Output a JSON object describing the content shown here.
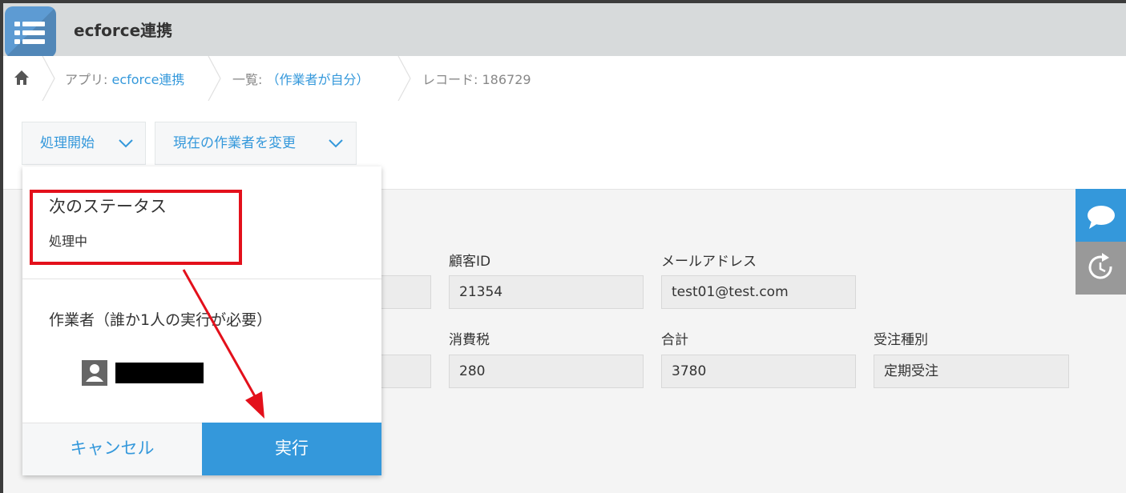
{
  "app": {
    "title": "ecforce連携"
  },
  "breadcrumb": {
    "app_prefix": "アプリ: ",
    "app_name": "ecforce連携",
    "list_prefix": "一覧: ",
    "list_name": "（作業者が自分）",
    "record": "レコード: 186729"
  },
  "toolbar": {
    "process_button": "処理開始",
    "change_assignee_button": "現在の作業者を変更"
  },
  "fields": {
    "customer_id": {
      "label": "顧客ID",
      "value": "21354"
    },
    "email": {
      "label": "メールアドレス",
      "value": "test01@test.com"
    },
    "tax": {
      "label": "消費税",
      "value": "280"
    },
    "total": {
      "label": "合計",
      "value": "3780"
    },
    "order_type": {
      "label": "受注種別",
      "value": "定期受注"
    }
  },
  "popup": {
    "next_status_title": "次のステータス",
    "next_status_value": "処理中",
    "assignee_title": "作業者（誰か1人の実行が必要）",
    "cancel_button": "キャンセル",
    "execute_button": "実行"
  },
  "side_buttons": [
    "comment-icon",
    "history-icon"
  ],
  "colors": {
    "accent": "#3498db",
    "header_bg": "#d7dadb",
    "annotation_red": "#e3101b",
    "side_comment_bg": "#3498db",
    "side_history_bg": "#999999"
  }
}
